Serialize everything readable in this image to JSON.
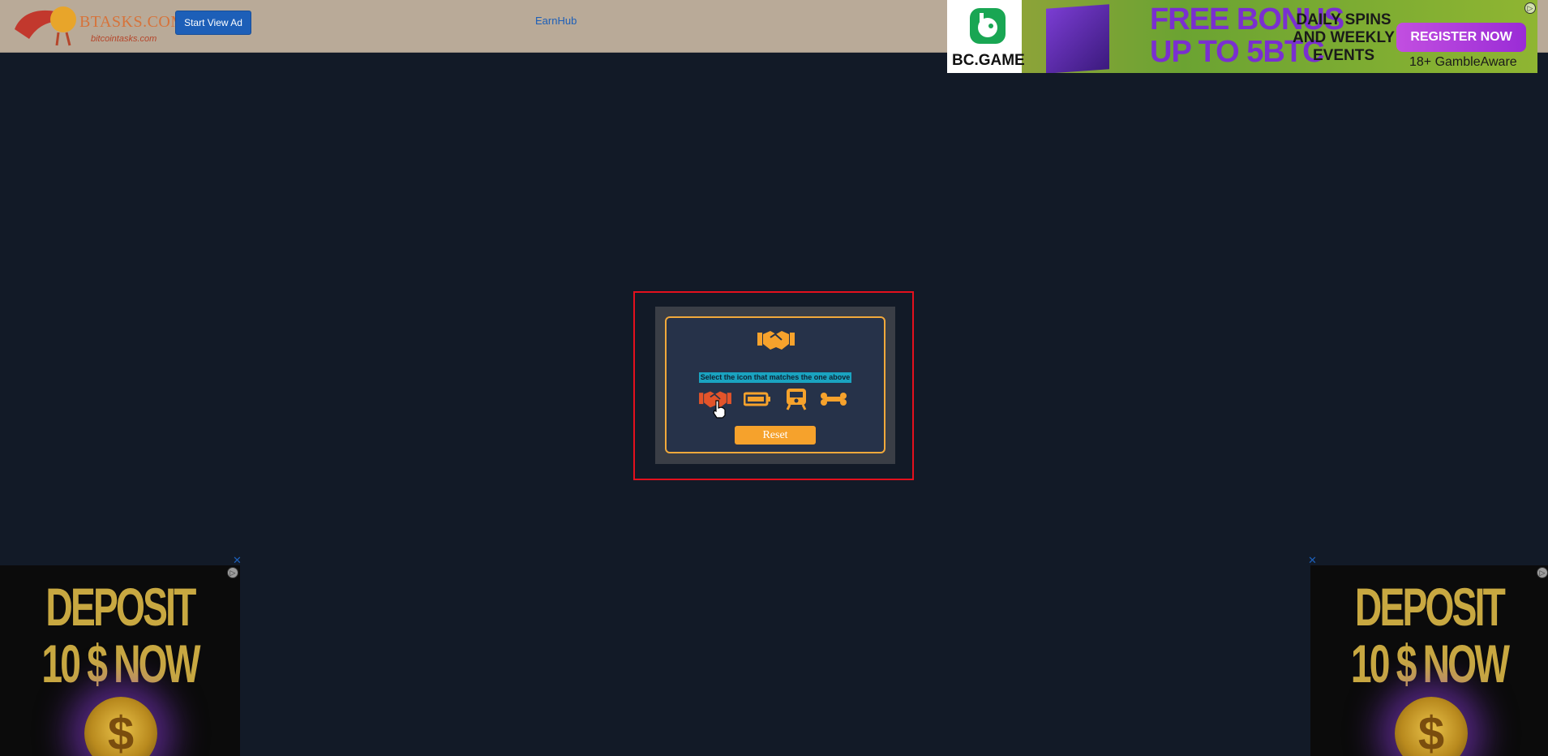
{
  "header": {
    "logo_text": "BTASKS.COM",
    "logo_subtext": "bitcointasks.com",
    "start_button_label": "Start View Ad",
    "earnhub_link": "EarnHub"
  },
  "top_banner": {
    "brand": "BC.GAME",
    "headline_line1": "FREE BONUS",
    "headline_line2": "UP TO 5BTC",
    "tagline_line1": "DAILY SPINS",
    "tagline_line2": "AND WEEKLY",
    "tagline_line3": "EVENTS",
    "cta_label": "REGISTER NOW",
    "disclaimer": "18+ GambleAware"
  },
  "captcha": {
    "target_icon": "handshake-icon",
    "instruction": "Select the icon that matches the one above",
    "options": [
      "handshake-icon",
      "battery-icon",
      "train-icon",
      "bone-icon"
    ],
    "reset_label": "Reset",
    "accent_color": "#f6a22c",
    "highlight_color": "#e3101d"
  },
  "side_ads": {
    "left": {
      "line1": "DEPOSIT",
      "line2": "10 $ NOW",
      "close": "✕",
      "coin_symbol": "$"
    },
    "right": {
      "line1": "DEPOSIT",
      "line2": "10 $ NOW",
      "close": "✕",
      "coin_symbol": "$"
    }
  }
}
